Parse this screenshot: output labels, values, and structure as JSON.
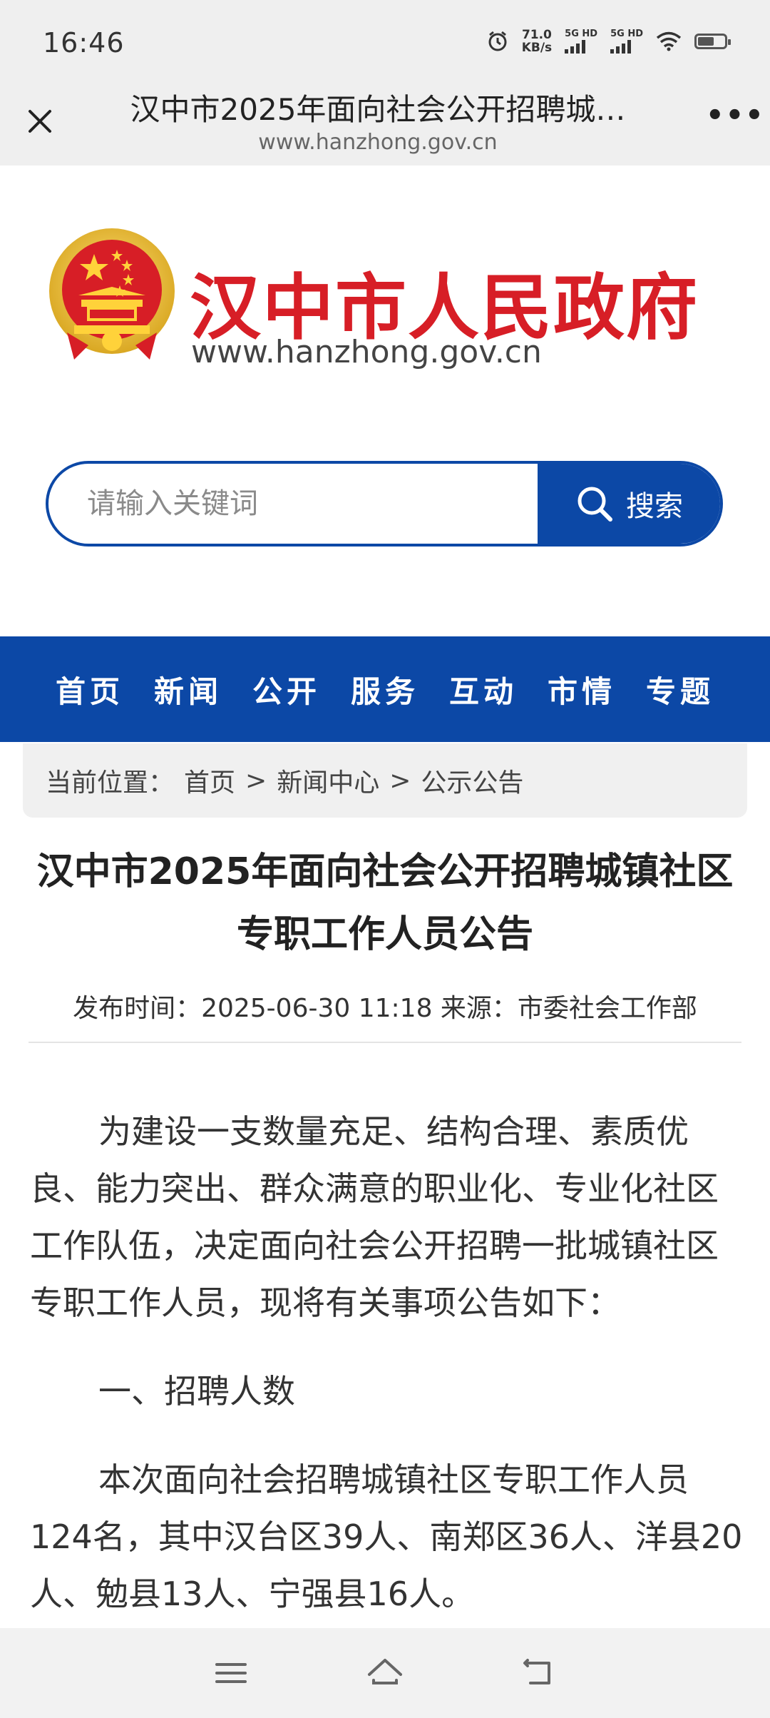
{
  "status_bar": {
    "time": "16:46",
    "net_speed_value": "71.0",
    "net_speed_unit": "KB/s",
    "sim1_label": "5G HD",
    "sim2_label": "5G HD",
    "battery_level": 0.6
  },
  "browser": {
    "tab_title": "汉中市2025年面向社会公开招聘城…",
    "url": "www.hanzhong.gov.cn"
  },
  "site": {
    "name": "汉中市人民政府",
    "url": "www.hanzhong.gov.cn",
    "search_placeholder": "请输入关键词",
    "search_button": "搜索"
  },
  "nav": [
    "首页",
    "新闻",
    "公开",
    "服务",
    "互动",
    "市情",
    "专题"
  ],
  "breadcrumb": {
    "label": "当前位置：",
    "items": [
      "首页",
      ">",
      "新闻中心",
      ">",
      "公示公告"
    ]
  },
  "article": {
    "title_line1": "汉中市2025年面向社会公开招聘城镇社区",
    "title_line2": "专职工作人员公告",
    "meta": "发布时间：2025-06-30 11:18 来源：市委社会工作部",
    "paragraphs": [
      "为建设一支数量充足、结构合理、素质优良、能力突出、群众满意的职业化、专业化社区工作队伍，决定面向社会公开招聘一批城镇社区专职工作人员，现将有关事项公告如下：",
      "一、招聘人数",
      "本次面向社会招聘城镇社区专职工作人员124名，其中汉台区39人、南郑区36人、洋县20人、勉县13人、宁强县16人。"
    ]
  },
  "colors": {
    "brand_red": "#d71e26",
    "nav_blue": "#0c48a6"
  }
}
